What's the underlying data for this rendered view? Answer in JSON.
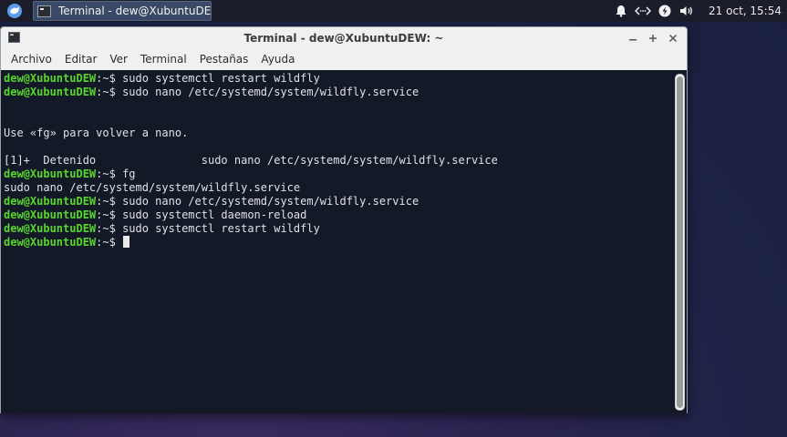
{
  "taskbar": {
    "task_title": "Terminal - dew@XubuntuDE...",
    "clock": "21 oct, 15:54",
    "icons": [
      "whisker-menu-icon",
      "notification-bell-icon",
      "network-icon",
      "power-icon",
      "volume-icon"
    ]
  },
  "window": {
    "title": "Terminal - dew@XubuntuDEW: ~",
    "buttons": [
      "minimize",
      "maximize",
      "close"
    ],
    "menu": [
      "Archivo",
      "Editar",
      "Ver",
      "Terminal",
      "Pestañas",
      "Ayuda"
    ]
  },
  "terminal": {
    "user": "dew@XubuntuDEW",
    "suffix": ":~$ ",
    "lines": [
      {
        "prompt": true,
        "text": "sudo systemctl restart wildfly"
      },
      {
        "prompt": true,
        "text": "sudo nano /etc/systemd/system/wildfly.service"
      },
      {
        "prompt": false,
        "text": ""
      },
      {
        "prompt": false,
        "text": ""
      },
      {
        "prompt": false,
        "text": "Use «fg» para volver a nano."
      },
      {
        "prompt": false,
        "text": ""
      },
      {
        "prompt": false,
        "text": "[1]+  Detenido                sudo nano /etc/systemd/system/wildfly.service"
      },
      {
        "prompt": true,
        "text": "fg"
      },
      {
        "prompt": false,
        "text": "sudo nano /etc/systemd/system/wildfly.service"
      },
      {
        "prompt": true,
        "text": "sudo nano /etc/systemd/system/wildfly.service"
      },
      {
        "prompt": true,
        "text": "sudo systemctl daemon-reload"
      },
      {
        "prompt": true,
        "text": "sudo systemctl restart wildfly"
      },
      {
        "prompt": true,
        "text": "",
        "cursor": true
      }
    ]
  },
  "colors": {
    "terminal_bg": "#131926",
    "prompt_user": "#58d62e",
    "panel_bg": "#1b1e2a"
  }
}
